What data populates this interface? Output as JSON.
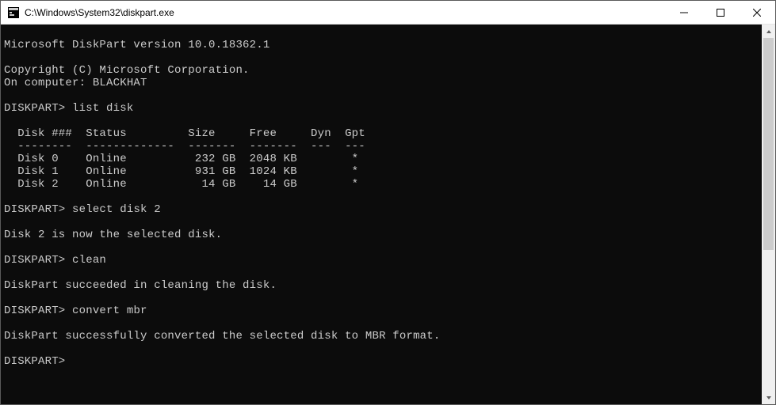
{
  "window": {
    "title": "C:\\Windows\\System32\\diskpart.exe"
  },
  "console": {
    "version_line": "Microsoft DiskPart version 10.0.18362.1",
    "copyright_line": "Copyright (C) Microsoft Corporation.",
    "computer_line": "On computer: BLACKHAT",
    "prompt": "DISKPART>",
    "cmd_list_disk": "list disk",
    "table_header": "  Disk ###  Status         Size     Free     Dyn  Gpt",
    "table_sep": "  --------  -------------  -------  -------  ---  ---",
    "disks": [
      {
        "id": "Disk 0",
        "status": "Online",
        "size": "232 GB",
        "free": "2048 KB",
        "dyn": "",
        "gpt": "*"
      },
      {
        "id": "Disk 1",
        "status": "Online",
        "size": "931 GB",
        "free": "1024 KB",
        "dyn": "",
        "gpt": "*"
      },
      {
        "id": "Disk 2",
        "status": "Online",
        "size": "14 GB",
        "free": "14 GB",
        "dyn": "",
        "gpt": "*"
      }
    ],
    "row_0": "  Disk 0    Online          232 GB  2048 KB        *",
    "row_1": "  Disk 1    Online          931 GB  1024 KB        *",
    "row_2": "  Disk 2    Online           14 GB    14 GB        *",
    "cmd_select": "select disk 2",
    "msg_selected": "Disk 2 is now the selected disk.",
    "cmd_clean": "clean",
    "msg_clean": "DiskPart succeeded in cleaning the disk.",
    "cmd_convert": "convert mbr",
    "msg_convert": "DiskPart successfully converted the selected disk to MBR format."
  }
}
